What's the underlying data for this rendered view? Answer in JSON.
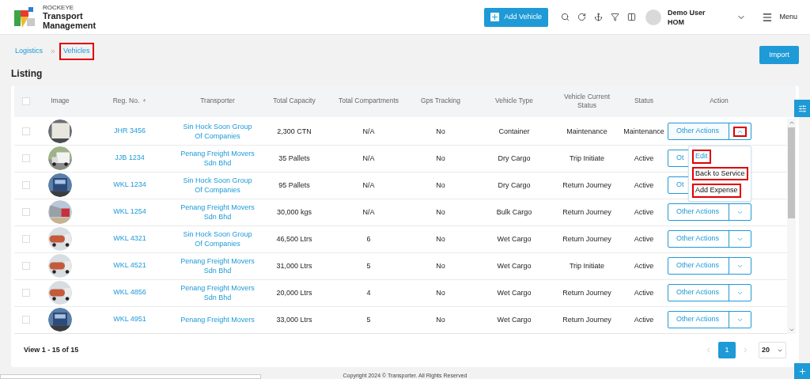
{
  "header": {
    "brand_small": "ROCKEYE",
    "brand_title": "Transport Management",
    "add_button": "Add Vehicle",
    "user_name": "Demo User",
    "user_role": "HOM",
    "menu_label": "Menu"
  },
  "breadcrumb": [
    {
      "label": "Logistics",
      "highlighted": false
    },
    {
      "label": "Vehicles",
      "highlighted": true
    }
  ],
  "page_title": "Listing",
  "import_button": "Import",
  "table": {
    "all_checked": false,
    "columns": [
      "Image",
      "Reg. No.",
      "Transporter",
      "Total Capacity",
      "Total Compartments",
      "Gps Tracking",
      "Vehicle Type",
      "Vehicle Current Status",
      "Status",
      "Action"
    ],
    "rows": [
      {
        "reg_no": "JHR 3456",
        "transporter": "Sin Hock Soon Group Of Companies",
        "capacity": "2,300 CTN",
        "compartments": "N/A",
        "gps": "No",
        "type": "Container",
        "current_status": "Maintenance",
        "status": "Maintenance",
        "action": "Other Actions",
        "expanded": true,
        "checked": false
      },
      {
        "reg_no": "JJB 1234",
        "transporter": "Penang Freight Movers Sdn Bhd",
        "capacity": "35 Pallets",
        "compartments": "N/A",
        "gps": "No",
        "type": "Dry Cargo",
        "current_status": "Trip Initiate",
        "status": "Active",
        "action": "Ot",
        "expanded": false,
        "checked": false
      },
      {
        "reg_no": "WKL 1234",
        "transporter": "Sin Hock Soon Group Of Companies",
        "capacity": "95 Pallets",
        "compartments": "N/A",
        "gps": "No",
        "type": "Dry Cargo",
        "current_status": "Return Journey",
        "status": "Active",
        "action": "Ot",
        "expanded": false,
        "checked": false
      },
      {
        "reg_no": "WKL 1254",
        "transporter": "Penang Freight Movers Sdn Bhd",
        "capacity": "30,000 kgs",
        "compartments": "N/A",
        "gps": "No",
        "type": "Bulk Cargo",
        "current_status": "Return Journey",
        "status": "Active",
        "action": "Other Actions",
        "expanded": false,
        "checked": false
      },
      {
        "reg_no": "WKL 4321",
        "transporter": "Sin Hock Soon Group Of Companies",
        "capacity": "46,500 Ltrs",
        "compartments": "6",
        "gps": "No",
        "type": "Wet Cargo",
        "current_status": "Return Journey",
        "status": "Active",
        "action": "Other Actions",
        "expanded": false,
        "checked": false
      },
      {
        "reg_no": "WKL 4521",
        "transporter": "Penang Freight Movers Sdn Bhd",
        "capacity": "31,000 Ltrs",
        "compartments": "5",
        "gps": "No",
        "type": "Wet Cargo",
        "current_status": "Trip Initiate",
        "status": "Active",
        "action": "Other Actions",
        "expanded": false,
        "checked": false
      },
      {
        "reg_no": "WKL 4856",
        "transporter": "Penang Freight Movers Sdn Bhd",
        "capacity": "20,000 Ltrs",
        "compartments": "4",
        "gps": "No",
        "type": "Wet Cargo",
        "current_status": "Return Journey",
        "status": "Active",
        "action": "Other Actions",
        "expanded": false,
        "checked": false
      },
      {
        "reg_no": "WKL 4951",
        "transporter": "Penang Freight Movers",
        "capacity": "33,000 Ltrs",
        "compartments": "5",
        "gps": "No",
        "type": "Wet Cargo",
        "current_status": "Return Journey",
        "status": "Active",
        "action": "Other Actions",
        "expanded": false,
        "checked": false
      }
    ]
  },
  "action_menu": [
    {
      "label": "Edit",
      "kind": "link",
      "highlighted": true
    },
    {
      "label": "Back to Service",
      "kind": "item",
      "highlighted": true
    },
    {
      "label": "Add Expense",
      "kind": "item",
      "highlighted": true
    }
  ],
  "footer": {
    "view_count": "View 1 - 15 of 15",
    "pages": [
      {
        "label": "1",
        "selected": true
      }
    ],
    "page_size": "20"
  },
  "copyright": "Copyright 2024 © Transporter. All Rights Reserved"
}
